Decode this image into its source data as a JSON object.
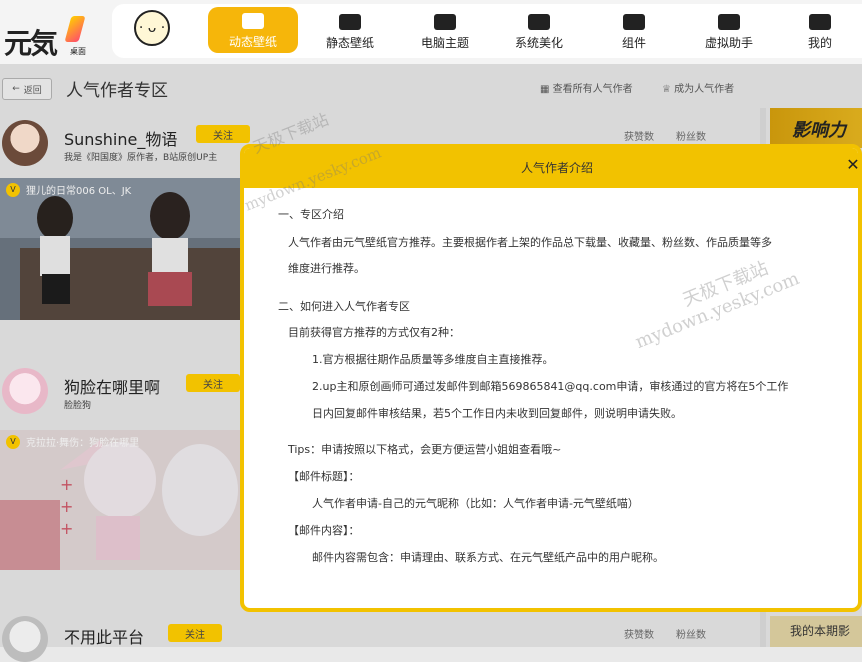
{
  "app": {
    "logo_text": "元気",
    "logo_sub": "桌面"
  },
  "nav": {
    "avatar_face": "· ᴗ ·",
    "items": [
      {
        "label": "动态壁纸",
        "icon": "play-icon",
        "active": true
      },
      {
        "label": "静态壁纸",
        "icon": "image-icon",
        "active": false
      },
      {
        "label": "电脑主题",
        "icon": "shirt-icon",
        "active": false
      },
      {
        "label": "系统美化",
        "icon": "flower-icon",
        "active": false
      },
      {
        "label": "组件",
        "icon": "widget-icon",
        "active": false
      },
      {
        "label": "虚拟助手",
        "icon": "paw-icon",
        "active": false
      },
      {
        "label": "我的",
        "icon": "user-icon",
        "active": false
      }
    ]
  },
  "page": {
    "back_label": "返回",
    "title": "人气作者专区",
    "link_all": "查看所有人气作者",
    "link_become": "成为人气作者"
  },
  "authors": [
    {
      "name": "Sunshine_物语",
      "follow": "关注",
      "desc": "我是《阳国度》原作者，B站原创UP主",
      "stat_downloads": "获赞数",
      "stat_fans": "粉丝数",
      "wallpaper_title": "狸儿的日常006 OL、JK"
    },
    {
      "name": "狗脸在哪里啊",
      "follow": "关注",
      "desc": "脸脸狗",
      "wallpaper_title": "克拉拉·舞伤：狗脸在哪里"
    },
    {
      "name": "不用此平台",
      "follow": "关注",
      "stat_downloads": "获赞数",
      "stat_fans": "粉丝数"
    }
  ],
  "sidebar": {
    "banner": "影响力",
    "bottom": "我的本期影"
  },
  "modal": {
    "title": "人气作者介绍",
    "close": "✕",
    "s1_heading": "一、专区介绍",
    "s1_p1": "人气作者由元气壁纸官方推荐。主要根据作者上架的作品总下载量、收藏量、粉丝数、作品质量等多",
    "s1_p2": "维度进行推荐。",
    "s2_heading": "二、如何进入人气作者专区",
    "s2_intro": "目前获得官方推荐的方式仅有2种：",
    "s2_item1": "1.官方根据往期作品质量等多维度自主直接推荐。",
    "s2_item2a": "2.up主和原创画师可通过发邮件到邮箱569865841@qq.com申请，审核通过的官方将在5个工作",
    "s2_item2b": "日内回复邮件审核结果，若5个工作日内未收到回复邮件，则说明申请失败。",
    "tips": "Tips：申请按照以下格式，会更方便运营小姐姐查看哦~",
    "mail_title_label": "【邮件标题】：",
    "mail_title": "人气作者申请-自己的元气昵称（比如：人气作者申请-元气壁纸喵）",
    "mail_body_label": "【邮件内容】：",
    "mail_body": "邮件内容需包含：申请理由、联系方式、在元气壁纸产品中的用户昵称。"
  },
  "watermark": {
    "line1": "天极下载站",
    "line2": "mydown.yesky.com"
  }
}
